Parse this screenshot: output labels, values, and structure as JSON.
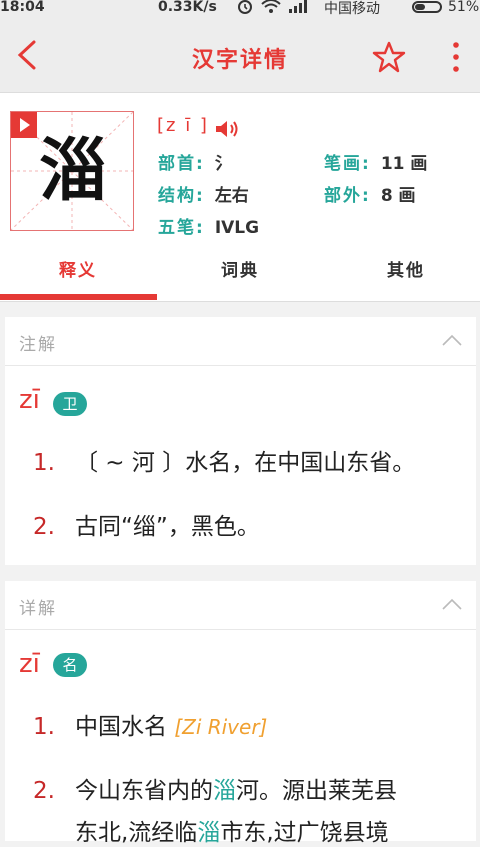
{
  "status": {
    "time": "18:04",
    "speed": "0.33K/s",
    "carrier": "中国移动",
    "battery": "51%"
  },
  "header": {
    "title": "汉字详情"
  },
  "char": {
    "glyph": "淄",
    "pinyin": "[z ī ]",
    "fields": {
      "radical_label": "部首:",
      "radical_value": "氵",
      "strokes_label": "笔画:",
      "strokes_value": "11 画",
      "structure_label": "结构:",
      "structure_value": "左右",
      "outer_label": "部外:",
      "outer_value": "8 画",
      "wubi_label": "五笔:",
      "wubi_value": "IVLG"
    }
  },
  "tabs": [
    {
      "label": "释义"
    },
    {
      "label": "词典"
    },
    {
      "label": "其他"
    }
  ],
  "note_card": {
    "title": "注解",
    "pinyin": "zī",
    "badge": "卫",
    "defs": [
      {
        "num": "1.",
        "text": "〔 ~ 河 〕水名，在中国山东省。"
      },
      {
        "num": "2.",
        "text": "古同“缁”，黑色。"
      }
    ]
  },
  "detail_card": {
    "title": "详解",
    "pinyin": "zī",
    "badge": "名",
    "defs": [
      {
        "num": "1.",
        "text": "中国水名",
        "en": "[Zi River]"
      },
      {
        "num": "2.",
        "text_a": "今山东省内的",
        "hl": "淄",
        "text_b": "河。源出莱芜县"
      },
      {
        "text_c": "东北,流经临",
        "hl2": "淄",
        "text_d": "市东,过广饶县境"
      }
    ]
  }
}
